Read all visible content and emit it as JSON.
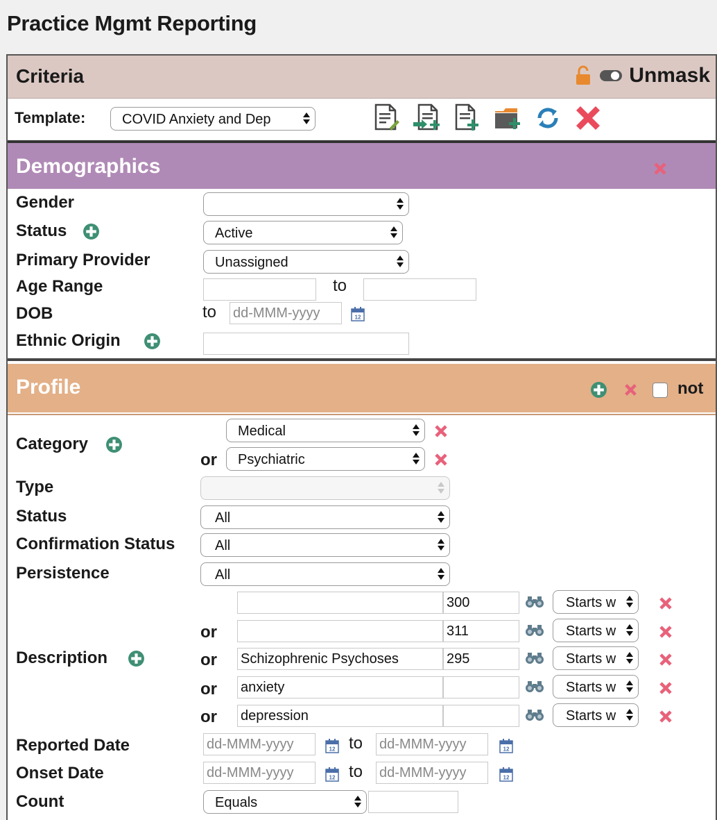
{
  "page_title": "Practice Mgmt Reporting",
  "criteria": {
    "title": "Criteria",
    "unmask_label": "Unmask",
    "template_label": "Template:",
    "template_value": "COVID Anxiety and Dep",
    "toolbar_icons": [
      "edit-document-icon",
      "import-document-icon",
      "add-document-icon",
      "add-folder-icon",
      "refresh-icon",
      "delete-icon"
    ]
  },
  "demographics": {
    "title": "Demographics",
    "gender_label": "Gender",
    "gender_value": "",
    "status_label": "Status",
    "status_value": "Active",
    "provider_label": "Primary Provider",
    "provider_value": "Unassigned",
    "age_label": "Age Range",
    "age_to": "to",
    "age_from_value": "",
    "age_to_value": "",
    "dob_label": "DOB",
    "dob_to": "to",
    "dob_placeholder": "dd-MMM-yyyy",
    "ethnic_label": "Ethnic Origin",
    "ethnic_value": ""
  },
  "profile": {
    "title": "Profile",
    "not_label": "not",
    "category_label": "Category",
    "category_values": [
      "Medical",
      "Psychiatric"
    ],
    "or_label": "or",
    "type_label": "Type",
    "type_value": "",
    "status_label": "Status",
    "status_value": "All",
    "confirmation_label": "Confirmation Status",
    "confirmation_value": "All",
    "persistence_label": "Persistence",
    "persistence_value": "All",
    "description_label": "Description",
    "descriptions": [
      {
        "text": "",
        "code": "300",
        "match": "Starts w"
      },
      {
        "text": "",
        "code": "311",
        "match": "Starts w"
      },
      {
        "text": "Schizophrenic Psychoses",
        "code": "295",
        "match": "Starts w"
      },
      {
        "text": "anxiety",
        "code": "",
        "match": "Starts w"
      },
      {
        "text": "depression",
        "code": "",
        "match": "Starts w"
      }
    ],
    "reported_label": "Reported Date",
    "onset_label": "Onset Date",
    "date_placeholder": "dd-MMM-yyyy",
    "to_label": "to",
    "count_label": "Count",
    "count_value": "Equals",
    "count_input": ""
  },
  "colors": {
    "criteria_bg": "#dcc8c3",
    "demographics_bg": "#b08ab6",
    "profile_bg": "#e3b088",
    "add_icon": "#3f8f73",
    "delete_icon": "#e8617a"
  }
}
